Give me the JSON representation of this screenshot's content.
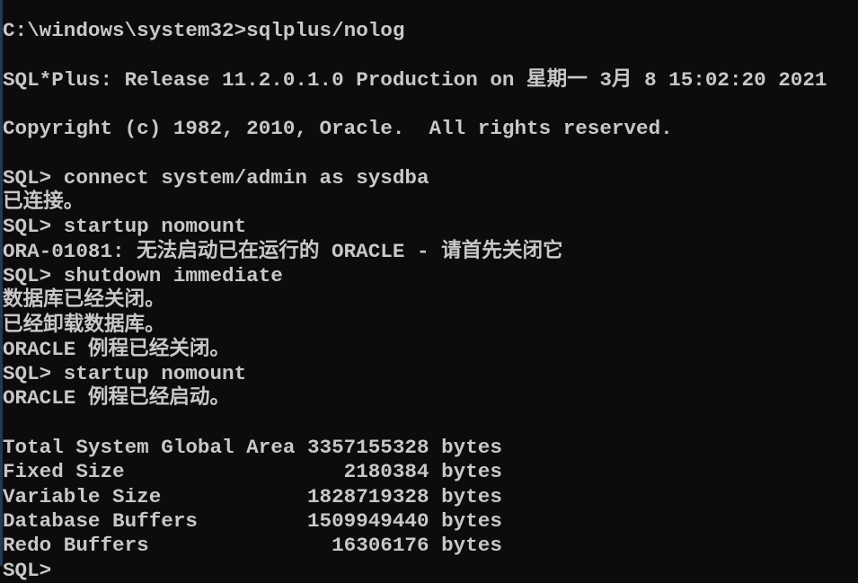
{
  "console": {
    "colors": {
      "background": "#0c0c0c",
      "text": "#c8c8c8"
    },
    "lines": [
      "C:\\windows\\system32>sqlplus/nolog",
      "",
      "SQL*Plus: Release 11.2.0.1.0 Production on 星期一 3月 8 15:02:20 2021",
      "",
      "Copyright (c) 1982, 2010, Oracle.  All rights reserved.",
      "",
      "SQL> connect system/admin as sysdba",
      "已连接。",
      "SQL> startup nomount",
      "ORA-01081: 无法启动已在运行的 ORACLE - 请首先关闭它",
      "SQL> shutdown immediate",
      "数据库已经关闭。",
      "已经卸载数据库。",
      "ORACLE 例程已经关闭。",
      "SQL> startup nomount",
      "ORACLE 例程已经启动。",
      "",
      "Total System Global Area 3357155328 bytes",
      "Fixed Size                  2180384 bytes",
      "Variable Size            1828719328 bytes",
      "Database Buffers         1509949440 bytes",
      "Redo Buffers               16306176 bytes",
      "SQL>"
    ]
  }
}
